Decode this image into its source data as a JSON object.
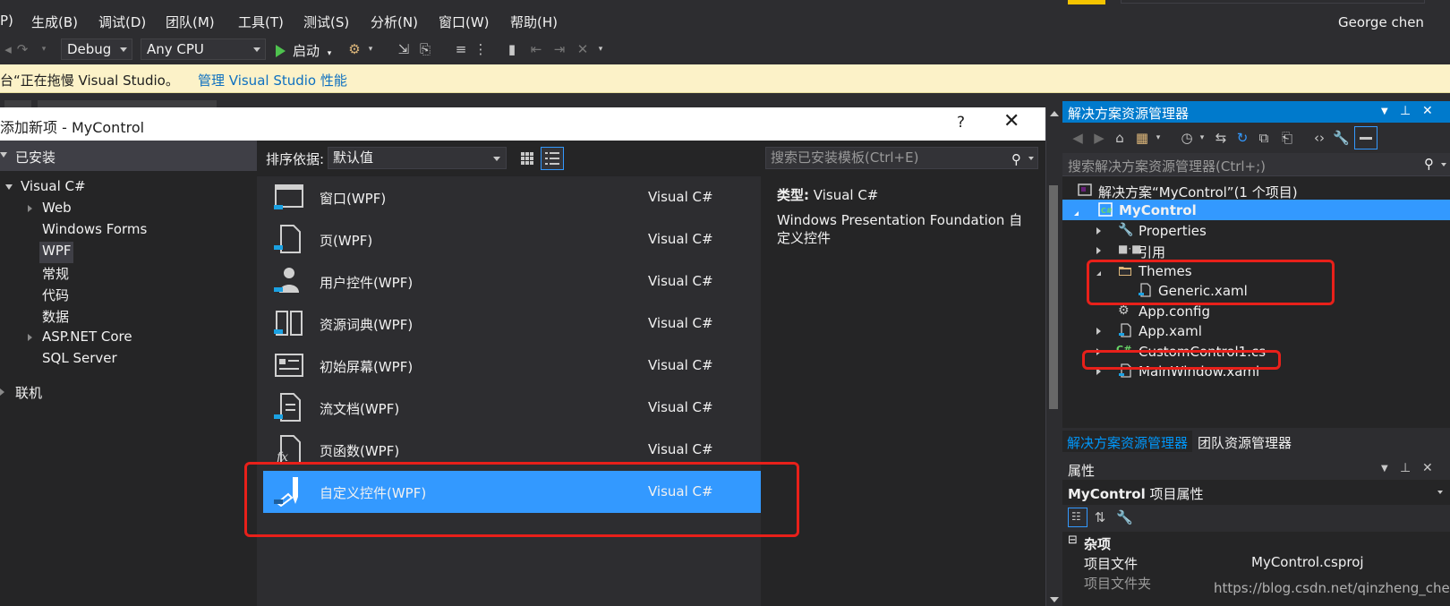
{
  "menu": {
    "items": [
      "P)",
      "生成(B)",
      "调试(D)",
      "团队(M)",
      "工具(T)",
      "测试(S)",
      "分析(N)",
      "窗口(W)",
      "帮助(H)"
    ],
    "user": "George chen"
  },
  "toolbar": {
    "config": "Debug",
    "platform": "Any CPU",
    "start_label": "启动"
  },
  "infobar": {
    "message": "台“正在拖慢 Visual Studio。",
    "link": "管理 Visual Studio 性能"
  },
  "dialog": {
    "title": "添加新项 - MyControl",
    "help": "?",
    "close": "✕",
    "installed_label": "已安装",
    "tree": {
      "visual_csharp": "Visual C#",
      "children": [
        "Web",
        "Windows Forms",
        "WPF",
        "常规",
        "代码",
        "数据",
        "ASP.NET Core",
        "SQL Server"
      ],
      "online": "联机"
    },
    "sort_label": "排序依据:",
    "sort_value": "默认值",
    "search_placeholder": "搜索已安装模板(Ctrl+E)",
    "templates": [
      {
        "name": "窗口(WPF)",
        "lang": "Visual C#"
      },
      {
        "name": "页(WPF)",
        "lang": "Visual C#"
      },
      {
        "name": "用户控件(WPF)",
        "lang": "Visual C#"
      },
      {
        "name": "资源词典(WPF)",
        "lang": "Visual C#"
      },
      {
        "name": "初始屏幕(WPF)",
        "lang": "Visual C#"
      },
      {
        "name": "流文档(WPF)",
        "lang": "Visual C#"
      },
      {
        "name": "页函数(WPF)",
        "lang": "Visual C#"
      },
      {
        "name": "自定义控件(WPF)",
        "lang": "Visual C#"
      }
    ],
    "selected_index": 7,
    "desc_type_label": "类型:",
    "desc_type_value": "Visual C#",
    "desc_text": "Windows Presentation Foundation 自定义控件"
  },
  "solution_explorer": {
    "title": "解决方案资源管理器",
    "search_placeholder": "搜索解决方案资源管理器(Ctrl+;)",
    "solution": "解决方案“MyControl”(1 个项目)",
    "project": "MyControl",
    "items": {
      "properties": "Properties",
      "references": "引用",
      "themes": "Themes",
      "generic": "Generic.xaml",
      "app_config": "App.config",
      "app_xaml": "App.xaml",
      "custom_control": "CustomControl1.cs",
      "main_window": "MainWindow.xaml"
    },
    "tab_active": "解决方案资源管理器",
    "tab_other": "团队资源管理器"
  },
  "properties": {
    "title": "属性",
    "object_name": "MyControl",
    "object_type": "项目属性",
    "category": "杂项",
    "rows": [
      {
        "key": "项目文件",
        "value": "MyControl.csproj"
      },
      {
        "key": "项目文件夹",
        "value": ""
      }
    ]
  },
  "watermark": "https://blog.csdn.net/qinzheng_chen",
  "colors": {
    "accent": "#007acc",
    "selection": "#3399ff",
    "annotation": "#e8201a",
    "infobar": "#fcf2c8"
  }
}
